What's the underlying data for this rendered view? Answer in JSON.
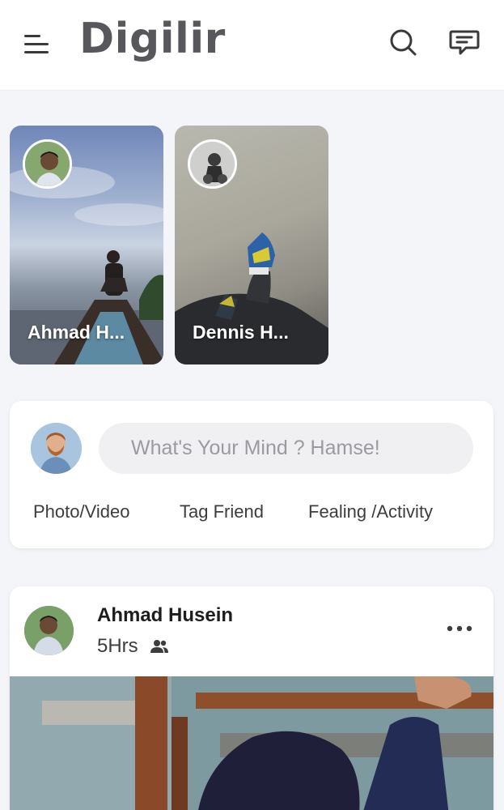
{
  "app": {
    "title": "Digilir"
  },
  "stories": [
    {
      "name": "Ahmad H..."
    },
    {
      "name": "Dennis H..."
    }
  ],
  "composer": {
    "placeholder": "What's Your Mind ? Hamse!",
    "actions": [
      "Photo/Video",
      "Tag Friend",
      "Fealing /Activity"
    ]
  },
  "post": {
    "author": "Ahmad Husein",
    "time": "5Hrs",
    "audience_icon": "friends-icon"
  },
  "icons": [
    "menu-icon",
    "search-icon",
    "chat-icon",
    "more-icon",
    "friends-icon"
  ],
  "colors": {
    "background": "#f4f5f9",
    "card": "#ffffff",
    "logo": "#58585c",
    "input_bg": "#f0f0f3"
  }
}
